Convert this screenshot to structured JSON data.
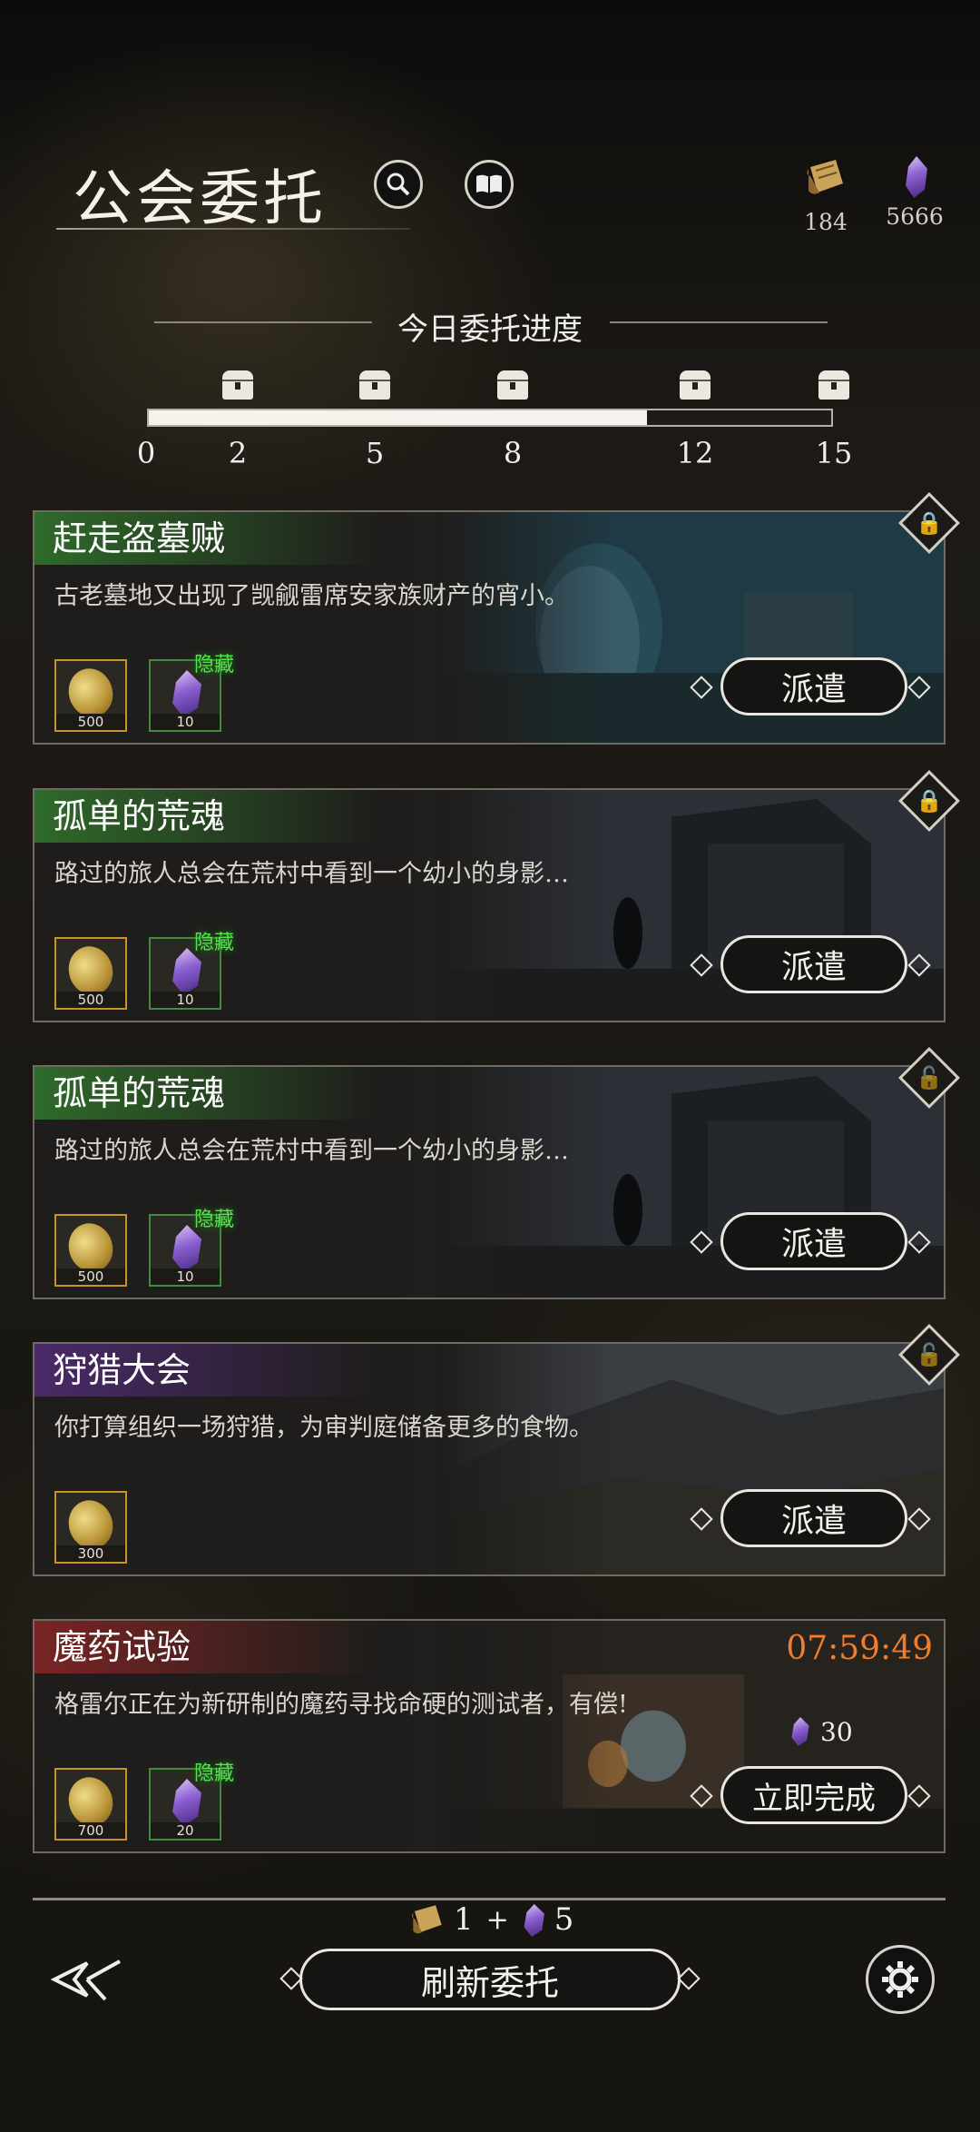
{
  "header": {
    "title": "公会委托",
    "icons": [
      "search-icon",
      "book-icon"
    ],
    "resources": [
      {
        "icon": "scroll-icon",
        "value": "184"
      },
      {
        "icon": "crystal-icon",
        "value": "5666"
      }
    ]
  },
  "progress": {
    "label": "今日委托进度",
    "current_fraction": 0.73,
    "ticks": [
      "0",
      "2",
      "5",
      "8",
      "12",
      "15"
    ]
  },
  "quests": [
    {
      "title": "赶走盗墓贼",
      "desc": "古老墓地又出现了觊觎雷席安家族财产的宵小。",
      "rewards": [
        {
          "type": "gold",
          "count": "500"
        },
        {
          "type": "crystal",
          "count": "10",
          "tag": "隐藏"
        }
      ],
      "button": "派遣",
      "lock": "locked",
      "head_color": "#2f6a2a"
    },
    {
      "title": "孤单的荒魂",
      "desc": "路过的旅人总会在荒村中看到一个幼小的身影…",
      "rewards": [
        {
          "type": "gold",
          "count": "500"
        },
        {
          "type": "crystal",
          "count": "10",
          "tag": "隐藏"
        }
      ],
      "button": "派遣",
      "lock": "locked",
      "head_color": "#2f6a2a"
    },
    {
      "title": "孤单的荒魂",
      "desc": "路过的旅人总会在荒村中看到一个幼小的身影…",
      "rewards": [
        {
          "type": "gold",
          "count": "500"
        },
        {
          "type": "crystal",
          "count": "10",
          "tag": "隐藏"
        }
      ],
      "button": "派遣",
      "lock": "unlocked",
      "head_color": "#2f6a2a"
    },
    {
      "title": "狩猎大会",
      "desc": "你打算组织一场狩猎，为审判庭储备更多的食物。",
      "rewards": [
        {
          "type": "gold",
          "count": "300"
        }
      ],
      "button": "派遣",
      "lock": "unlocked",
      "head_color": "#4a2a6a"
    },
    {
      "title": "魔药试验",
      "desc": "格雷尔正在为新研制的魔药寻找命硬的测试者，有偿!",
      "rewards": [
        {
          "type": "gold",
          "count": "700"
        },
        {
          "type": "crystal",
          "count": "20",
          "tag": "隐藏"
        }
      ],
      "button": "立即完成",
      "timer": "07:59:49",
      "cost": "30",
      "head_color": "#7a2424"
    }
  ],
  "footer": {
    "cost_scroll": "1",
    "plus": "+",
    "cost_crystal": "5",
    "refresh_label": "刷新委托"
  }
}
